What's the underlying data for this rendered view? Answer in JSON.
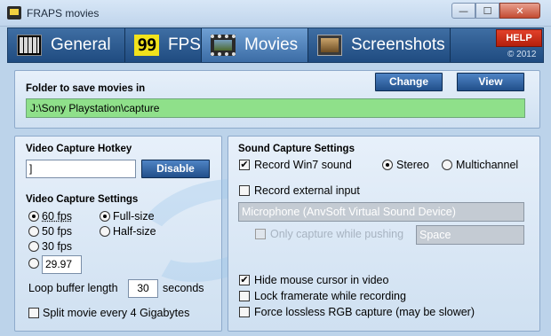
{
  "window": {
    "title": "FRAPS movies",
    "minimize_glyph": "—",
    "maximize_glyph": "☐",
    "close_glyph": "✕"
  },
  "tabs": [
    {
      "label": "General",
      "icon": "general-icon"
    },
    {
      "label": "FPS",
      "icon": "fps-icon",
      "icon_text": "99"
    },
    {
      "label": "Movies",
      "icon": "movies-icon",
      "active": true
    },
    {
      "label": "Screenshots",
      "icon": "screenshots-icon"
    }
  ],
  "help": {
    "label": "HELP",
    "copyright": "© 2012"
  },
  "folder": {
    "heading": "Folder to save movies in",
    "path": "J:\\Sony Playstation\\capture",
    "change_label": "Change",
    "view_label": "View",
    "color": "#8fe08a"
  },
  "video": {
    "hotkey_heading": "Video Capture Hotkey",
    "hotkey_value": "]",
    "disable_label": "Disable",
    "settings_heading": "Video Capture Settings",
    "fps_options": [
      {
        "label": "60 fps",
        "selected": true
      },
      {
        "label": "50 fps",
        "selected": false
      },
      {
        "label": "30 fps",
        "selected": false
      }
    ],
    "custom_fps_value": "29.97",
    "size_options": [
      {
        "label": "Full-size",
        "selected": true
      },
      {
        "label": "Half-size",
        "selected": false
      }
    ],
    "loop_label": "Loop buffer length",
    "loop_value": "30",
    "loop_unit": "seconds",
    "split_label": "Split movie every 4 Gigabytes",
    "split_checked": false
  },
  "sound": {
    "heading": "Sound Capture Settings",
    "record_win7_label": "Record Win7 sound",
    "record_win7_checked": true,
    "channel_options": [
      {
        "label": "Stereo",
        "selected": true
      },
      {
        "label": "Multichannel",
        "selected": false
      }
    ],
    "external_label": "Record external input",
    "external_checked": false,
    "device_value": "Microphone (AnvSoft Virtual Sound Device)",
    "push_label": "Only capture while pushing",
    "push_key_value": "Space"
  },
  "misc": {
    "hide_cursor_label": "Hide mouse cursor in video",
    "hide_cursor_checked": true,
    "lock_framerate_label": "Lock framerate while recording",
    "lock_framerate_checked": false,
    "lossless_label": "Force lossless RGB capture (may be slower)",
    "lossless_checked": false
  }
}
